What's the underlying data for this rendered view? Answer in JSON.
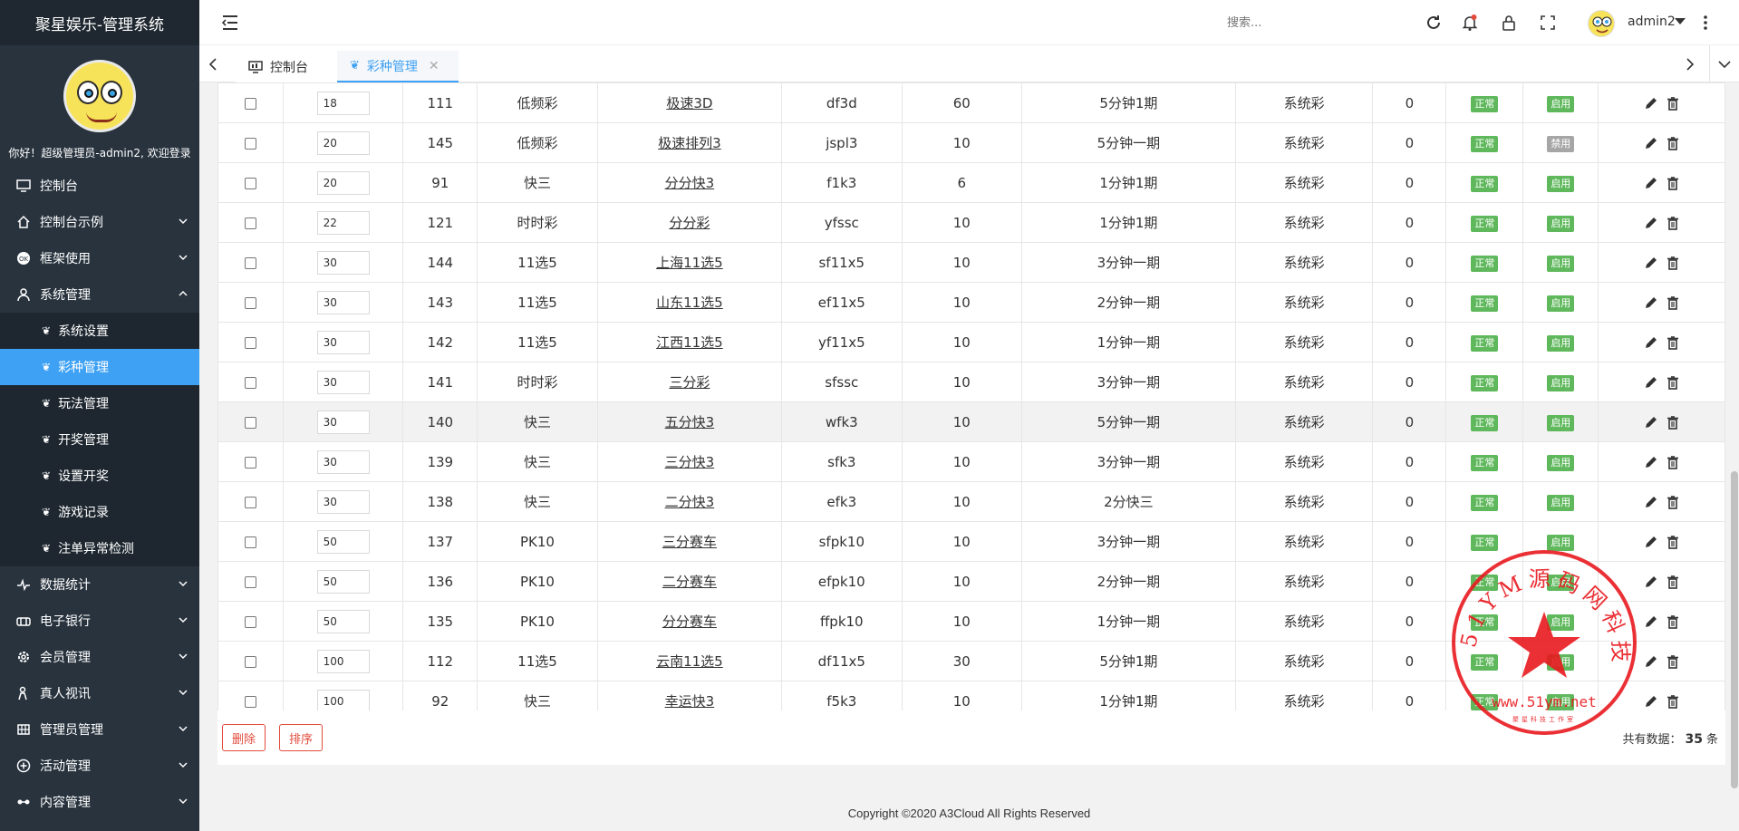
{
  "app": {
    "title": "聚星娱乐-管理系统"
  },
  "profile": {
    "welcome": "你好！超级管理员-admin2, 欢迎登录"
  },
  "sidebar": {
    "items": [
      {
        "label": "控制台",
        "icon": "monitor-icon",
        "expandable": false
      },
      {
        "label": "控制台示例",
        "icon": "home-icon",
        "expandable": true
      },
      {
        "label": "框架使用",
        "icon": "ok-icon",
        "expandable": true
      },
      {
        "label": "系统管理",
        "icon": "user-icon",
        "expandable": true,
        "expanded": true
      },
      {
        "label": "数据统计",
        "icon": "pulse-icon",
        "expandable": true
      },
      {
        "label": "电子银行",
        "icon": "bank-icon",
        "expandable": true
      },
      {
        "label": "会员管理",
        "icon": "gear-icon",
        "expandable": true
      },
      {
        "label": "真人视讯",
        "icon": "person-icon",
        "expandable": true
      },
      {
        "label": "管理员管理",
        "icon": "grid-icon",
        "expandable": true
      },
      {
        "label": "活动管理",
        "icon": "plus-circle-icon",
        "expandable": true
      },
      {
        "label": "内容管理",
        "icon": "link-icon",
        "expandable": true
      }
    ],
    "sub_items": [
      {
        "label": "系统设置",
        "active": false
      },
      {
        "label": "彩种管理",
        "active": true
      },
      {
        "label": "玩法管理",
        "active": false
      },
      {
        "label": "开奖管理",
        "active": false
      },
      {
        "label": "设置开奖",
        "active": false
      },
      {
        "label": "游戏记录",
        "active": false
      },
      {
        "label": "注单异常检测",
        "active": false
      }
    ]
  },
  "header": {
    "search_placeholder": "搜索...",
    "username": "admin2"
  },
  "tabs": [
    {
      "label": "控制台",
      "icon": "monitor-icon"
    },
    {
      "label": "彩种管理",
      "icon": "leaf-icon",
      "closable": true
    }
  ],
  "table": {
    "rows": [
      {
        "sort": "18",
        "id": "111",
        "category": "低频彩",
        "name": "极速3D",
        "code": "df3d",
        "seconds": "60",
        "period": "5分钟1期",
        "type": "系统彩",
        "count": "0",
        "status": "正常",
        "enabled": "启用"
      },
      {
        "sort": "20",
        "id": "145",
        "category": "低频彩",
        "name": "极速排列3",
        "code": "jspl3",
        "seconds": "10",
        "period": "5分钟一期",
        "type": "系统彩",
        "count": "0",
        "status": "正常",
        "enabled": "禁用"
      },
      {
        "sort": "20",
        "id": "91",
        "category": "快三",
        "name": "分分快3",
        "code": "f1k3",
        "seconds": "6",
        "period": "1分钟1期",
        "type": "系统彩",
        "count": "0",
        "status": "正常",
        "enabled": "启用"
      },
      {
        "sort": "22",
        "id": "121",
        "category": "时时彩",
        "name": "分分彩",
        "code": "yfssc",
        "seconds": "10",
        "period": "1分钟1期",
        "type": "系统彩",
        "count": "0",
        "status": "正常",
        "enabled": "启用"
      },
      {
        "sort": "30",
        "id": "144",
        "category": "11选5",
        "name": "上海11选5",
        "code": "sf11x5",
        "seconds": "10",
        "period": "3分钟一期",
        "type": "系统彩",
        "count": "0",
        "status": "正常",
        "enabled": "启用"
      },
      {
        "sort": "30",
        "id": "143",
        "category": "11选5",
        "name": "山东11选5",
        "code": "ef11x5",
        "seconds": "10",
        "period": "2分钟一期",
        "type": "系统彩",
        "count": "0",
        "status": "正常",
        "enabled": "启用"
      },
      {
        "sort": "30",
        "id": "142",
        "category": "11选5",
        "name": "江西11选5",
        "code": "yf11x5",
        "seconds": "10",
        "period": "1分钟一期",
        "type": "系统彩",
        "count": "0",
        "status": "正常",
        "enabled": "启用"
      },
      {
        "sort": "30",
        "id": "141",
        "category": "时时彩",
        "name": "三分彩",
        "code": "sfssc",
        "seconds": "10",
        "period": "3分钟一期",
        "type": "系统彩",
        "count": "0",
        "status": "正常",
        "enabled": "启用"
      },
      {
        "sort": "30",
        "id": "140",
        "category": "快三",
        "name": "五分快3",
        "code": "wfk3",
        "seconds": "10",
        "period": "5分钟一期",
        "type": "系统彩",
        "count": "0",
        "status": "正常",
        "enabled": "启用",
        "highlight": true
      },
      {
        "sort": "30",
        "id": "139",
        "category": "快三",
        "name": "三分快3",
        "code": "sfk3",
        "seconds": "10",
        "period": "3分钟一期",
        "type": "系统彩",
        "count": "0",
        "status": "正常",
        "enabled": "启用"
      },
      {
        "sort": "30",
        "id": "138",
        "category": "快三",
        "name": "二分快3",
        "code": "efk3",
        "seconds": "10",
        "period": "2分快三",
        "type": "系统彩",
        "count": "0",
        "status": "正常",
        "enabled": "启用"
      },
      {
        "sort": "50",
        "id": "137",
        "category": "PK10",
        "name": "三分赛车",
        "code": "sfpk10",
        "seconds": "10",
        "period": "3分钟一期",
        "type": "系统彩",
        "count": "0",
        "status": "正常",
        "enabled": "启用"
      },
      {
        "sort": "50",
        "id": "136",
        "category": "PK10",
        "name": "二分赛车",
        "code": "efpk10",
        "seconds": "10",
        "period": "2分钟一期",
        "type": "系统彩",
        "count": "0",
        "status": "正常",
        "enabled": "启用"
      },
      {
        "sort": "50",
        "id": "135",
        "category": "PK10",
        "name": "分分赛车",
        "code": "ffpk10",
        "seconds": "10",
        "period": "1分钟一期",
        "type": "系统彩",
        "count": "0",
        "status": "正常",
        "enabled": "启用"
      },
      {
        "sort": "100",
        "id": "112",
        "category": "11选5",
        "name": "云南11选5",
        "code": "df11x5",
        "seconds": "30",
        "period": "5分钟1期",
        "type": "系统彩",
        "count": "0",
        "status": "正常",
        "enabled": "启用"
      },
      {
        "sort": "100",
        "id": "92",
        "category": "快三",
        "name": "幸运快3",
        "code": "f5k3",
        "seconds": "10",
        "period": "1分钟1期",
        "type": "系统彩",
        "count": "0",
        "status": "正常",
        "enabled": "启用"
      }
    ]
  },
  "footer": {
    "delete_label": "删除",
    "sort_label": "排序",
    "total_prefix": "共有数据：",
    "total_count": "35",
    "total_suffix": "条"
  },
  "copyright": "Copyright ©2020 A3Cloud All Rights Reserved",
  "stamp": {
    "ring_text": "51YM源码网科技",
    "url": "www.51ym.net",
    "bottom_text": "聚星科技工作室",
    "color": "#e8191f"
  },
  "colors": {
    "sidebar_bg": "#28333e",
    "accent": "#3ea1f4",
    "badge_green": "#5fb85c",
    "badge_gray": "#a6a6a6",
    "danger": "#e24b3b"
  }
}
